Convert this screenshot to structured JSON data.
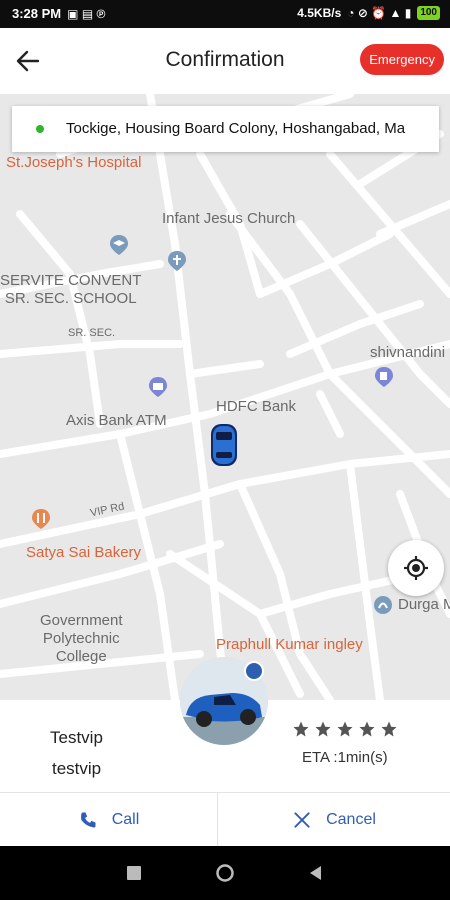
{
  "status_bar": {
    "time": "3:28 PM",
    "speed": "4.5KB/s",
    "battery": "100"
  },
  "header": {
    "title": "Confirmation",
    "emergency_label": "Emergency"
  },
  "map": {
    "address": "Tockige, Housing Board Colony, Hoshangabad, Ma",
    "labels": {
      "hospital": "St.Joseph's Hospital",
      "church": "Infant Jesus Church",
      "school_line1": "SERVITE CONVENT",
      "school_line2": "SR. SEC. SCHOOL",
      "sr_sec": "SR. SEC.",
      "shivnandini": "shivnandini",
      "hdfc": "HDFC Bank",
      "axis": "Axis Bank ATM",
      "vip_rd": "VIP Rd",
      "bakery": "Satya Sai Bakery",
      "durga": "Durga M",
      "college_line1": "Government",
      "college_line2": "Polytechnic",
      "college_line3": "College",
      "praphull": "Praphull Kumar ingley"
    }
  },
  "driver": {
    "name": "Testvip",
    "subtitle": "testvip",
    "rating": 5,
    "eta": "ETA :1min(s)"
  },
  "actions": {
    "call_label": "Call",
    "cancel_label": "Cancel"
  },
  "colors": {
    "accent": "#2f5db8",
    "emergency": "#e8302a",
    "online_dot": "#2fb52c",
    "place_orange": "#d9643b"
  },
  "icons": {
    "back": "back-arrow-icon",
    "locate": "my-location-icon",
    "call": "phone-icon",
    "cancel": "close-icon",
    "star": "star-icon"
  }
}
